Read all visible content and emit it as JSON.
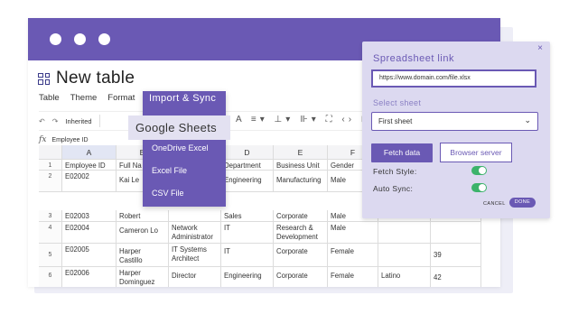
{
  "colors": {
    "accent": "#6a59b4",
    "panel_bg": "#dcd9f0",
    "toggle_on": "#3cb36b"
  },
  "doc": {
    "title": "New table",
    "icon": "table-grid-icon"
  },
  "menu": {
    "table": "Table",
    "theme": "Theme",
    "format": "Format"
  },
  "toolbar": {
    "font_value": "Inherited",
    "font_a": "A"
  },
  "formula": {
    "fx": "fx",
    "value": "Employee ID"
  },
  "import_menu": {
    "header": "Import & Sync",
    "highlighted": "Google Sheets",
    "items": [
      "OneDrive Excel",
      "Excel File",
      "CSV File"
    ]
  },
  "sheet": {
    "col_letters": [
      "A",
      "B",
      "C",
      "D",
      "E",
      "F",
      "G",
      "H"
    ],
    "rows": [
      {
        "num": "1",
        "cells": [
          "Employee ID",
          "Full Na",
          "",
          "Department",
          "Business Unit",
          "Gender",
          "",
          ""
        ]
      },
      {
        "num": "2",
        "cells": [
          "E02002",
          "Kai Le",
          "",
          "Engineering",
          "Manufacturing",
          "Male",
          "",
          ""
        ]
      },
      {
        "num": "3",
        "cells": [
          "E02003",
          "Robert",
          "",
          "Sales",
          "Corporate",
          "Male",
          "",
          ""
        ]
      },
      {
        "num": "4",
        "cells": [
          "E02004",
          "Cameron Lo",
          "Network\nAdministrator",
          "IT",
          "Research &\nDevelopment",
          "Male",
          "",
          ""
        ]
      },
      {
        "num": "5",
        "cells": [
          "E02005",
          "Harper Castillo",
          "IT Systems\nArchitect",
          "IT",
          "Corporate",
          "Female",
          "",
          "39"
        ]
      },
      {
        "num": "6",
        "cells": [
          "E02006",
          "Harper\nDominguez",
          "Director",
          "Engineering",
          "Corporate",
          "Female",
          "Latino",
          "42"
        ]
      }
    ]
  },
  "panel": {
    "close": "×",
    "title": "Spreadsheet link",
    "url": "https://www.domain.com/file.xlsx",
    "select_label": "Select sheet",
    "selected_sheet": "First sheet",
    "fetch": "Fetch data",
    "browser": "Browser server",
    "fetch_style": "Fetch Style:",
    "auto_sync": "Auto Sync:",
    "fetch_style_on": true,
    "auto_sync_on": true,
    "cancel": "CANCEL",
    "done": "DONE"
  }
}
